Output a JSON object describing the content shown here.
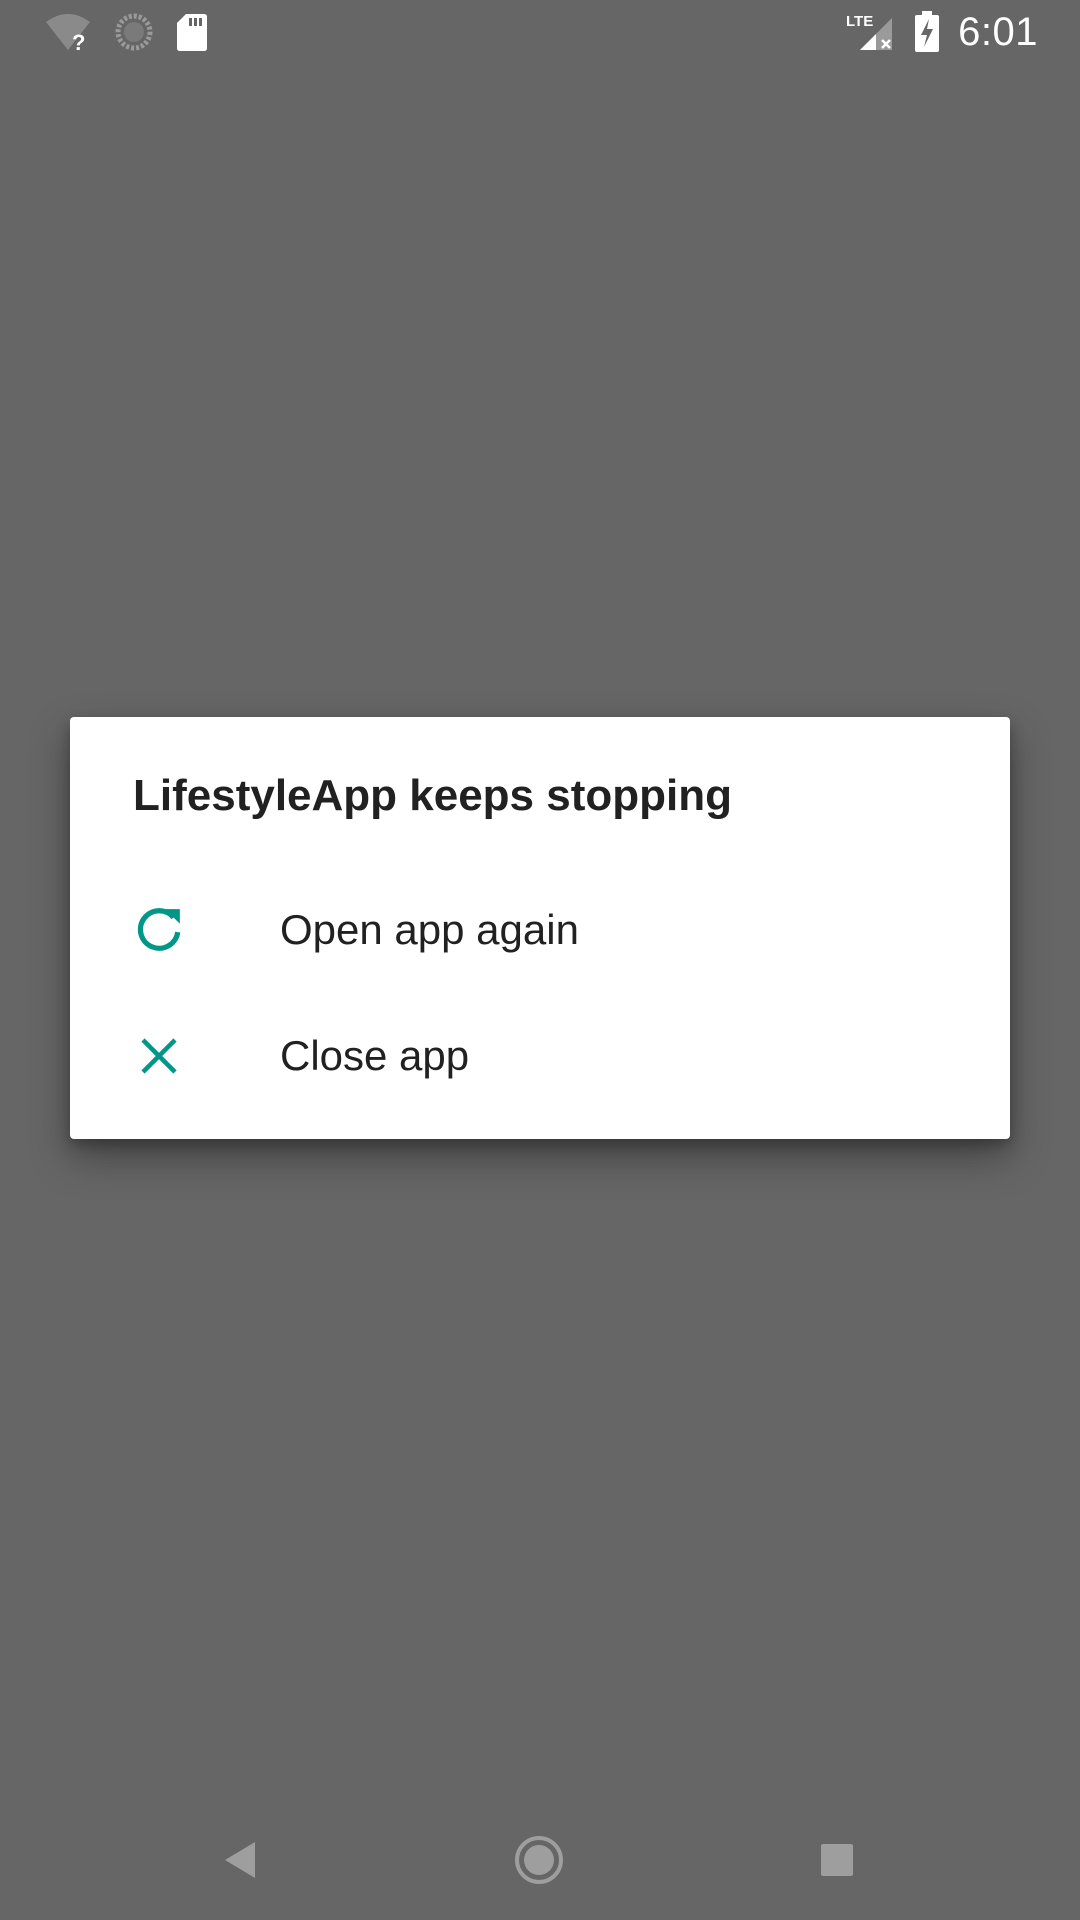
{
  "status_bar": {
    "time": "6:01",
    "network_label": "LTE",
    "icons": [
      "wifi-unknown-icon",
      "sync-icon",
      "sd-card-icon",
      "lte-signal-no-service-icon",
      "battery-charging-icon"
    ]
  },
  "dialog": {
    "title": "LifestyleApp keeps stopping",
    "options": [
      {
        "label": "Open app again",
        "icon": "refresh-icon"
      },
      {
        "label": "Close app",
        "icon": "close-icon"
      }
    ],
    "accent_color": "#009688"
  },
  "nav_bar": {
    "buttons": [
      "back-icon",
      "home-icon",
      "recents-icon"
    ]
  },
  "colors": {
    "scrim_background": "#666666",
    "dialog_background": "#ffffff",
    "text_primary": "#212121"
  }
}
